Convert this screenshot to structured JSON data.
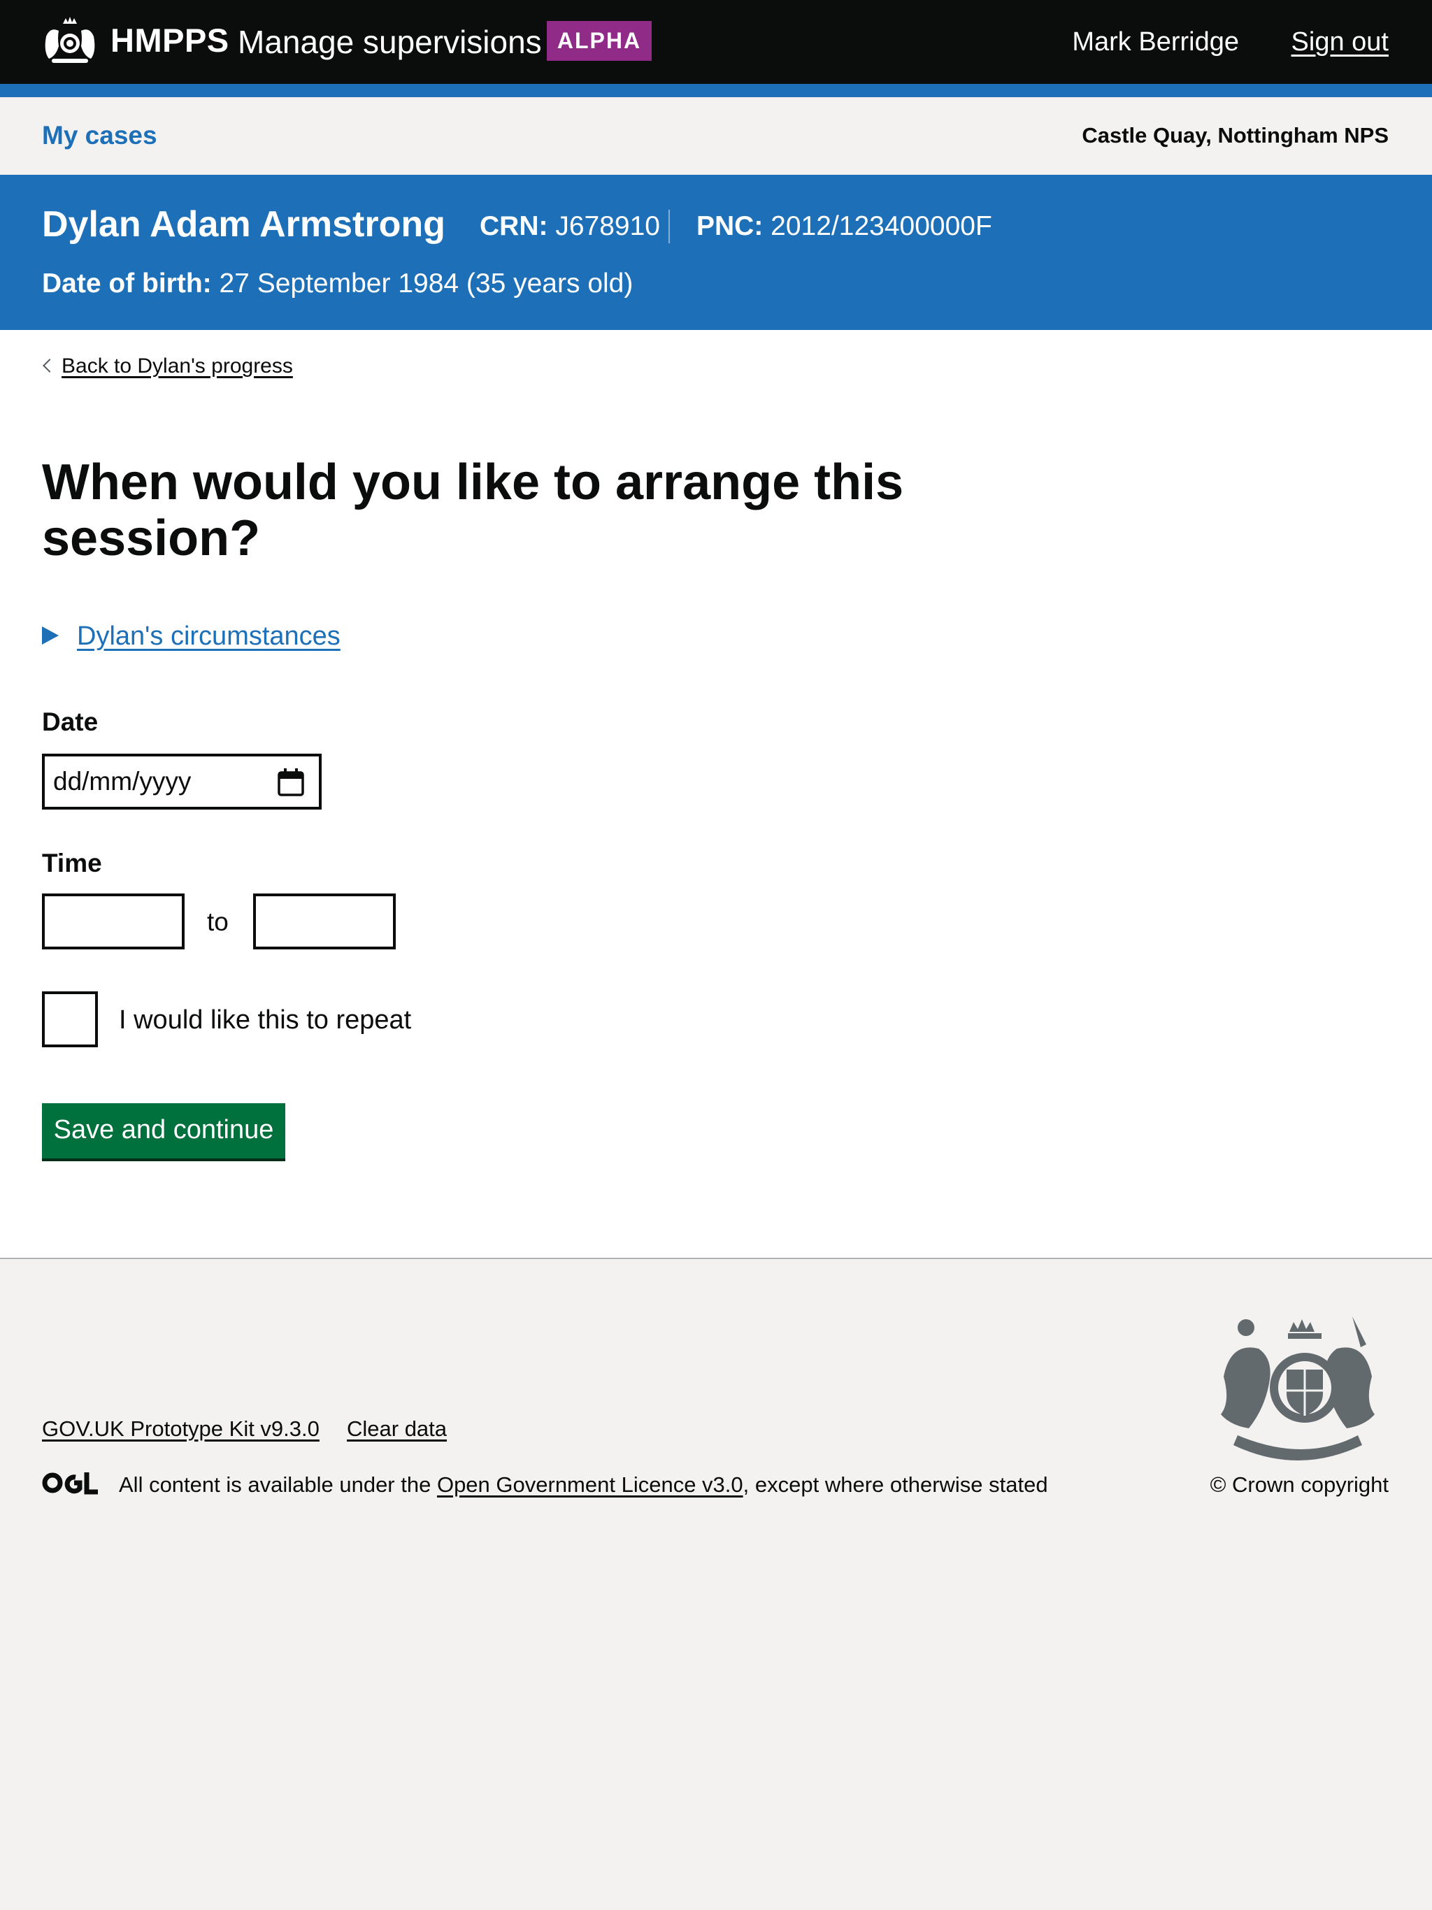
{
  "header": {
    "org_name": "HMPPS",
    "service_name": "Manage supervisions",
    "phase_tag": "ALPHA",
    "user_name": "Mark Berridge",
    "sign_out_label": "Sign out",
    "icons": {
      "crest": "royal-crest-icon"
    },
    "colors": {
      "background": "#0b0c0c",
      "accent_bar": "#1d70b8",
      "phase_tag": "#912b88"
    }
  },
  "subnav": {
    "link_label": "My cases",
    "office": "Castle Quay, Nottingham NPS"
  },
  "offender": {
    "name": "Dylan Adam Armstrong",
    "crn_label": "CRN:",
    "crn_value": " J678910",
    "pnc_label": "PNC:",
    "pnc_value": " 2012/123400000F",
    "dob_label": "Date of birth:",
    "dob_value": " 27 September 1984 (35 years old)"
  },
  "main": {
    "back_link": "Back to Dylan's progress",
    "title": "When would you like to arrange this session?",
    "details_summary": "Dylan's circumstances",
    "date": {
      "label": "Date",
      "placeholder": "dd/mm/yyyy",
      "value": ""
    },
    "time": {
      "label": "Time",
      "separator": "to",
      "start_value": "",
      "end_value": ""
    },
    "repeat_checkbox": {
      "label": "I would like this to repeat",
      "checked": false
    },
    "submit_label": "Save and continue",
    "colors": {
      "button": "#00703c",
      "link": "#1d70b8"
    }
  },
  "footer": {
    "links": [
      "GOV.UK Prototype Kit v9.3.0",
      "Clear data"
    ],
    "ogl_label": "OGL",
    "licence_prefix": "All content is available under the ",
    "licence_link": "Open Government Licence v3.0",
    "licence_suffix": ", except where otherwise stated",
    "copyright": "© Crown copyright",
    "icons": {
      "ogl": "ogl-logo-icon",
      "arms": "royal-coat-of-arms-icon"
    }
  }
}
